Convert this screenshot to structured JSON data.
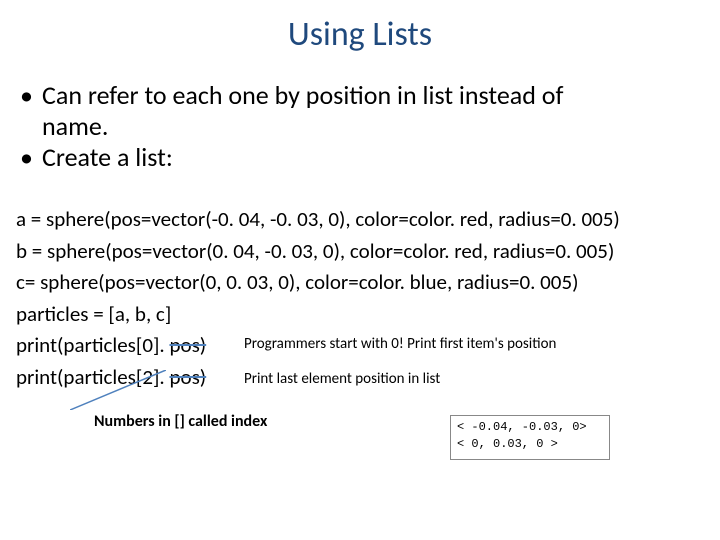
{
  "title": "Using Lists",
  "bullets": {
    "b1a": "Can refer to each one by position in list instead of",
    "b1b": "name.",
    "b2": "Create a list:"
  },
  "code": {
    "l1": "a = sphere(pos=vector(-0. 04, -0. 03, 0), color=color. red, radius=0. 005)",
    "l2": "b = sphere(pos=vector(0. 04, -0. 03, 0), color=color. red, radius=0. 005)",
    "l3": "c= sphere(pos=vector(0, 0. 03, 0), color=color. blue, radius=0. 005)",
    "l4": "particles = [a, b, c]",
    "l5a": "print(particles[0]. ",
    "l5b": "pos)",
    "l6a": "print(particles[2]. ",
    "l6b": "pos)"
  },
  "annot": {
    "a1": "Programmers start with 0!  Print first item's position",
    "a2": "Print last element position in list",
    "a3": "Numbers in [] called index"
  },
  "output": {
    "o1": "< -0.04, -0.03, 0>",
    "o2": "< 0, 0.03, 0 >"
  }
}
